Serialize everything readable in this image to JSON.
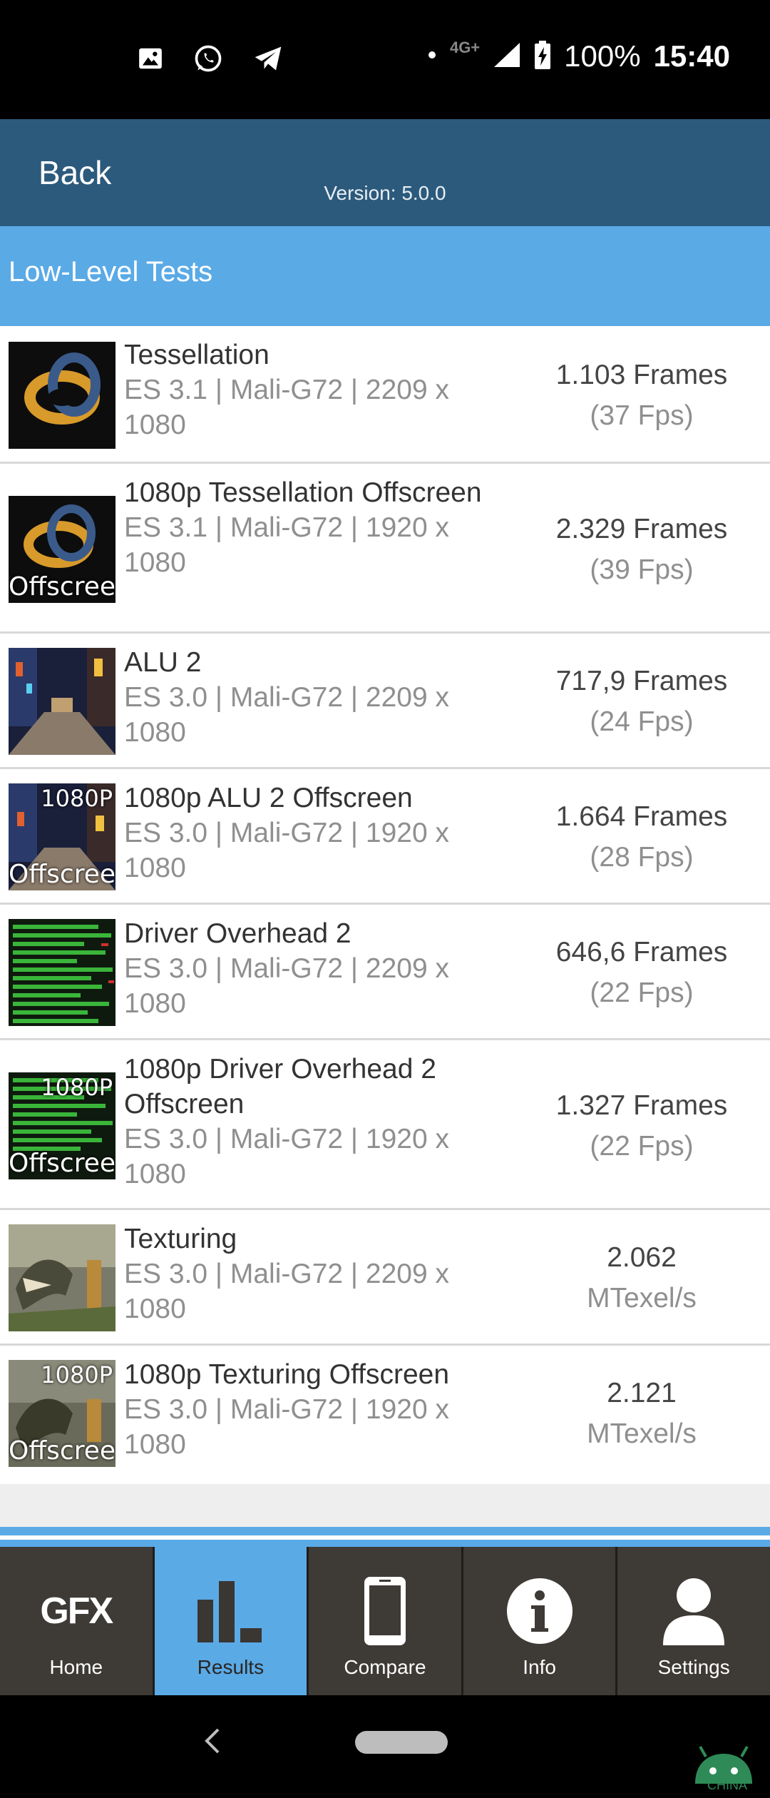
{
  "status_bar": {
    "network": "4G+",
    "battery": "100%",
    "time": "15:40",
    "icons": [
      "image-icon",
      "whatsapp-icon",
      "telegram-icon",
      "dot-icon",
      "signal-icon",
      "battery-charging-icon"
    ]
  },
  "header": {
    "back_label": "Back",
    "version": "Version: 5.0.0"
  },
  "section": {
    "title": "Low-Level Tests"
  },
  "tests": [
    {
      "name": "Tessellation",
      "detail": "ES 3.1 | Mali-G72 | 2209 x 1080",
      "score": "1.103 Frames",
      "score_sub": "(37 Fps)",
      "thumb_label": "",
      "thumb_tag": ""
    },
    {
      "name": "1080p Tessellation Offscreen",
      "detail": "ES 3.1 | Mali-G72 | 1920 x 1080",
      "score": "2.329 Frames",
      "score_sub": "(39 Fps)",
      "thumb_label": "Offscreen",
      "thumb_tag": ""
    },
    {
      "name": "ALU 2",
      "detail": "ES 3.0 | Mali-G72 | 2209 x 1080",
      "score": "717,9 Frames",
      "score_sub": "(24 Fps)",
      "thumb_label": "",
      "thumb_tag": ""
    },
    {
      "name": "1080p ALU 2 Offscreen",
      "detail": "ES 3.0 | Mali-G72 | 1920 x 1080",
      "score": "1.664 Frames",
      "score_sub": "(28 Fps)",
      "thumb_label": "Offscreen",
      "thumb_tag": "1080P"
    },
    {
      "name": "Driver Overhead 2",
      "detail": "ES 3.0 | Mali-G72 | 2209 x 1080",
      "score": "646,6 Frames",
      "score_sub": "(22 Fps)",
      "thumb_label": "",
      "thumb_tag": ""
    },
    {
      "name": "1080p Driver Overhead 2 Offscreen",
      "detail": "ES 3.0 | Mali-G72 | 1920 x 1080",
      "score": "1.327 Frames",
      "score_sub": "(22 Fps)",
      "thumb_label": "Offscreen",
      "thumb_tag": "1080P"
    },
    {
      "name": "Texturing",
      "detail": "ES 3.0 | Mali-G72 | 2209 x 1080",
      "score": "2.062",
      "score_sub": "MTexel/s",
      "thumb_label": "",
      "thumb_tag": ""
    },
    {
      "name": "1080p Texturing Offscreen",
      "detail": "ES 3.0 | Mali-G72 | 1920 x 1080",
      "score": "2.121",
      "score_sub": "MTexel/s",
      "thumb_label": "Offscreen",
      "thumb_tag": "1080P"
    }
  ],
  "nav": {
    "gfx_logo": "GFX",
    "items": [
      {
        "label": "Home",
        "icon": "gfx-logo-icon",
        "active": false
      },
      {
        "label": "Results",
        "icon": "bar-chart-icon",
        "active": true
      },
      {
        "label": "Compare",
        "icon": "phone-icon",
        "active": false
      },
      {
        "label": "Info",
        "icon": "info-icon",
        "active": false
      },
      {
        "label": "Settings",
        "icon": "user-icon",
        "active": false
      }
    ]
  },
  "watermark": {
    "text": "CHINA"
  },
  "colors": {
    "header": "#2c5a7c",
    "section": "#5aaae6",
    "nav_bg": "#3e3a35",
    "nav_active": "#5aaae6"
  }
}
